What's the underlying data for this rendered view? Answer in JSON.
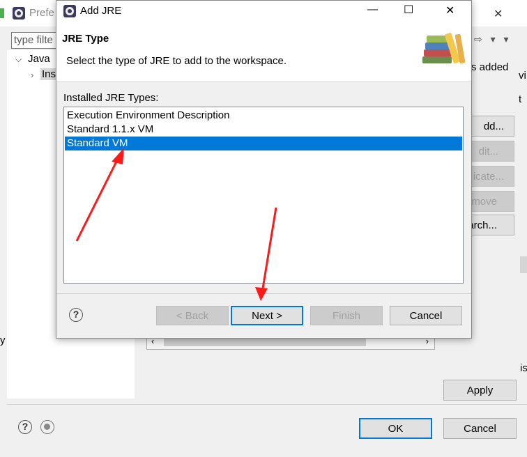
{
  "background_window": {
    "title": "Prefe",
    "filter_placeholder": "type filte",
    "tree": {
      "java_label": "Java",
      "installed_label": "Inst"
    },
    "partial_text": {
      "added": "s added",
      "vi": "vi",
      "t": "t",
      "is": "is",
      "y": "y"
    },
    "side_buttons": {
      "add": "dd...",
      "edit": "dit...",
      "duplicate": "icate...",
      "remove": "move",
      "search": "arch..."
    },
    "apply_label": "Apply",
    "ok_label": "OK",
    "cancel_label": "Cancel",
    "close_glyph": "✕",
    "nav_glyphs": "⇨ ▾ ▾"
  },
  "dialog": {
    "title": "Add JRE",
    "minimize_glyph": "—",
    "maximize_glyph": "☐",
    "close_glyph": "✕",
    "header_title": "JRE Type",
    "header_description": "Select the type of JRE to add to the workspace.",
    "list_label": "Installed JRE Types:",
    "jre_types": [
      {
        "label": "Execution Environment Description",
        "selected": false
      },
      {
        "label": "Standard 1.1.x VM",
        "selected": false
      },
      {
        "label": "Standard VM",
        "selected": true
      }
    ],
    "buttons": {
      "back": "< Back",
      "next": "Next >",
      "finish": "Finish",
      "cancel": "Cancel"
    },
    "help_glyph": "?"
  },
  "annotations": {
    "arrow_color": "#ff1a1a"
  },
  "colors": {
    "selection": "#0078d7",
    "focus_border": "#0078d7"
  }
}
